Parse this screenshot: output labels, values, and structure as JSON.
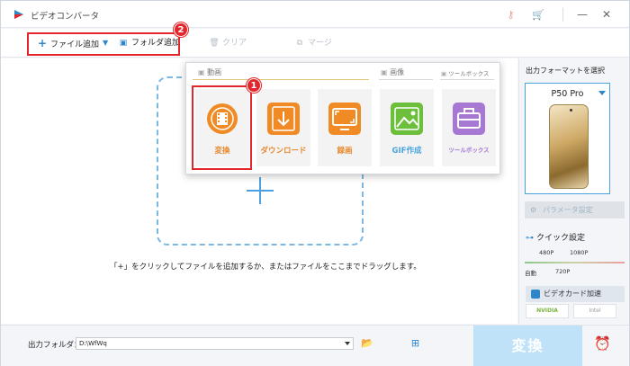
{
  "window": {
    "title": "ビデオコンバータ"
  },
  "toolbar": {
    "add_file": "ファイル追加",
    "add_folder": "フォルダ追加",
    "clear": "クリア",
    "merge": "マージ"
  },
  "badges": {
    "one": "1",
    "two": "2"
  },
  "popup": {
    "sections": {
      "video": "動画",
      "image": "画像",
      "toolbox": "ツールボックス"
    },
    "tiles": [
      {
        "label": "変換",
        "icon": "film-convert-icon"
      },
      {
        "label": "ダウンロード",
        "icon": "download-icon"
      },
      {
        "label": "録画",
        "icon": "screen-record-icon"
      },
      {
        "label": "GIF作成",
        "icon": "gif-maker-icon"
      },
      {
        "label": "ツールボックス",
        "icon": "toolbox-icon"
      }
    ]
  },
  "main": {
    "hint": "「+」をクリックしてファイルを追加するか、またはファイルをここまでドラッグします。"
  },
  "right_panel": {
    "title": "出力フォーマットを選択",
    "device": "P50 Pro",
    "params": "パラメータ設定",
    "quick": "クイック設定",
    "quality_labels": {
      "p480": "480P",
      "p1080": "1080P",
      "auto": "自動",
      "p720": "720P"
    },
    "gpu": "ビデオカード加速",
    "chips": {
      "nvidia": "NVIDIA",
      "intel": "Intel"
    }
  },
  "bottom": {
    "output_label": "出力フォルダ：",
    "output_path": "D:\\WfWq",
    "convert": "変換"
  },
  "colors": {
    "accent": "#2e86c9",
    "highlight": "#e3262b",
    "tile_orange": "#f08a24"
  }
}
